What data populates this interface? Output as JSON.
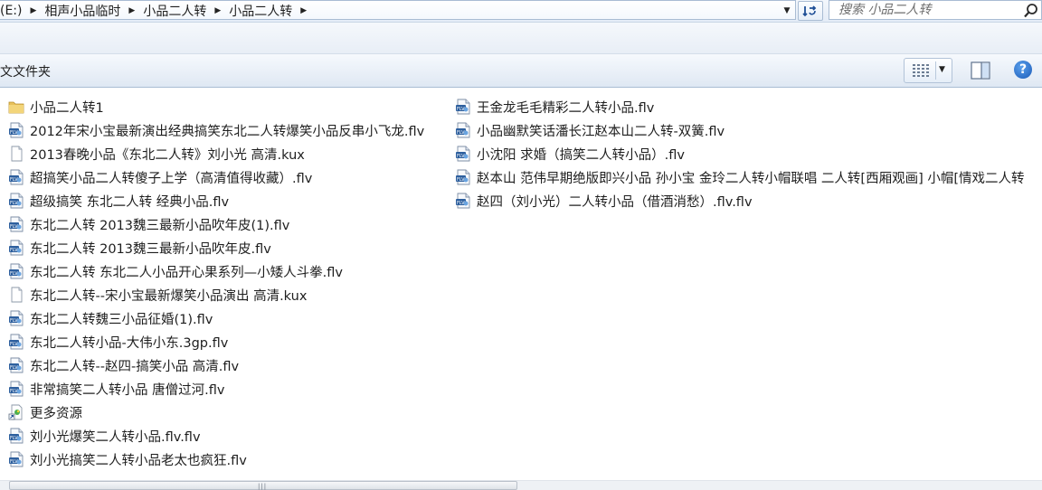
{
  "address_bar": {
    "crumbs": [
      "(E:)",
      "相声小品临时",
      "小品二人转",
      "小品二人转"
    ]
  },
  "search": {
    "placeholder": "搜索 小品二人转"
  },
  "toolbar": {
    "new_folder_label": "文文件夹"
  },
  "colors": {
    "text": "#1e1e1e",
    "folder": "#e8c15b",
    "accent_blue": "#1b5bb8"
  },
  "files": {
    "column_1": [
      {
        "name": "小品二人转1",
        "icon": "folder-icon"
      },
      {
        "name": "2012年宋小宝最新演出经典搞笑东北二人转爆笑小品反串小飞龙.flv",
        "icon": "flv-file-icon"
      },
      {
        "name": "2013春晚小品《东北二人转》刘小光 高清.kux",
        "icon": "blank-file-icon"
      },
      {
        "name": "超搞笑小品二人转傻子上学（高清值得收藏）.flv",
        "icon": "flv-file-icon"
      },
      {
        "name": "超级搞笑 东北二人转 经典小品.flv",
        "icon": "flv-file-icon"
      },
      {
        "name": "东北二人转 2013魏三最新小品吹年皮(1).flv",
        "icon": "flv-file-icon"
      },
      {
        "name": "东北二人转 2013魏三最新小品吹年皮.flv",
        "icon": "flv-file-icon"
      },
      {
        "name": "东北二人转 东北二人小品开心果系列—小矮人斗拳.flv",
        "icon": "flv-file-icon"
      },
      {
        "name": "东北二人转--宋小宝最新爆笑小品演出 高清.kux",
        "icon": "blank-file-icon"
      },
      {
        "name": "东北二人转魏三小品征婚(1).flv",
        "icon": "flv-file-icon"
      },
      {
        "name": "东北二人转小品-大伟小东.3gp.flv",
        "icon": "flv-file-icon"
      },
      {
        "name": "东北二人转--赵四-搞笑小品 高清.flv",
        "icon": "flv-file-icon"
      },
      {
        "name": "非常搞笑二人转小品 唐僧过河.flv",
        "icon": "flv-file-icon"
      },
      {
        "name": "更多资源",
        "icon": "shortcut-file-icon"
      },
      {
        "name": "刘小光爆笑二人转小品.flv.flv",
        "icon": "flv-file-icon"
      },
      {
        "name": "刘小光搞笑二人转小品老太也疯狂.flv",
        "icon": "flv-file-icon"
      }
    ],
    "column_2": [
      {
        "name": "王金龙毛毛精彩二人转小品.flv",
        "icon": "flv-file-icon"
      },
      {
        "name": "小品幽默笑话潘长江赵本山二人转-双簧.flv",
        "icon": "flv-file-icon"
      },
      {
        "name": "小沈阳 求婚（搞笑二人转小品）.flv",
        "icon": "flv-file-icon"
      },
      {
        "name": "赵本山 范伟早期绝版即兴小品 孙小宝 金玲二人转小帽联唱  二人转[西厢观画] 小帽[情戏二人转",
        "icon": "flv-file-icon"
      },
      {
        "name": "赵四（刘小光）二人转小品（借酒消愁）.flv.flv",
        "icon": "flv-file-icon"
      }
    ]
  }
}
